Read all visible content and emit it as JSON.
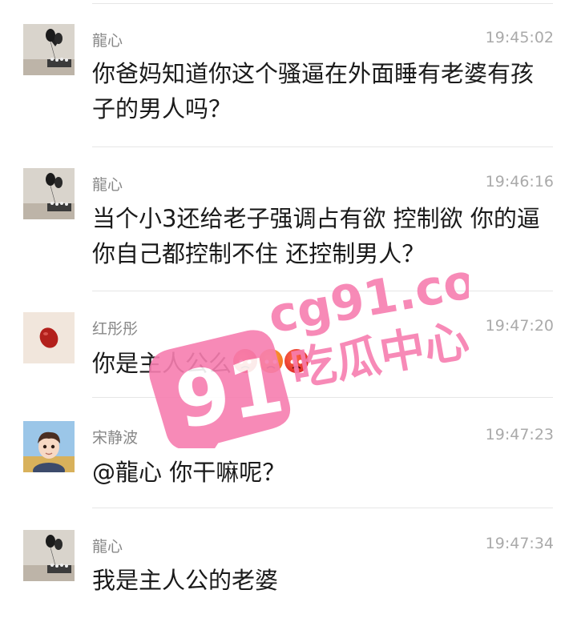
{
  "messages": [
    {
      "name": "龍心",
      "time": "19:45:02",
      "text": "你爸妈知道你这个骚逼在外面睡有老婆有孩子的男人吗？",
      "avatar": "balloon-room-avatar"
    },
    {
      "name": "龍心",
      "time": "19:46:16",
      "text": "当个小3还给老子强调占有欲 控制欲  你的逼你自己都控制不住 还控制男人？",
      "avatar": "balloon-room-avatar"
    },
    {
      "name": "红彤彤",
      "time": "19:47:20",
      "text": "你是主人公么",
      "avatar": "red-bean-avatar",
      "emojis": [
        "angry-face-emoji",
        "angry-face-emoji",
        "angry-face-emoji"
      ]
    },
    {
      "name": "宋静波",
      "time": "19:47:23",
      "text": "@龍心 你干嘛呢？",
      "avatar": "cartoon-boy-avatar"
    },
    {
      "name": "龍心",
      "time": "19:47:34",
      "text": "我是主人公的老婆",
      "avatar": "balloon-room-avatar"
    }
  ],
  "watermark": {
    "big": "91",
    "site": "cg91.co",
    "label": "吃瓜中心",
    "color": "#f77eb0"
  }
}
